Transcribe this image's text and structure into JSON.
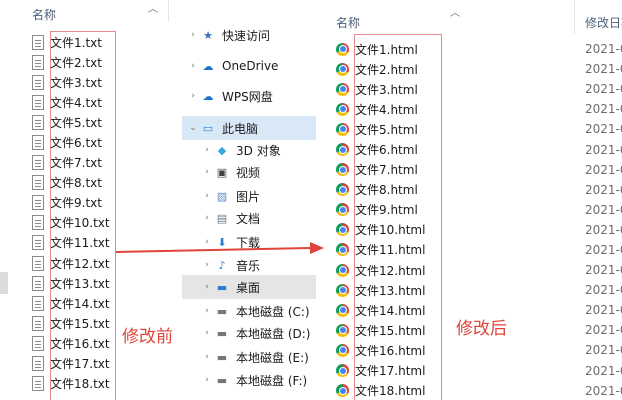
{
  "left_pane": {
    "column_header": "名称",
    "files": [
      "文件1.txt",
      "文件2.txt",
      "文件3.txt",
      "文件4.txt",
      "文件5.txt",
      "文件6.txt",
      "文件7.txt",
      "文件8.txt",
      "文件9.txt",
      "文件10.txt",
      "文件11.txt",
      "文件12.txt",
      "文件13.txt",
      "文件14.txt",
      "文件15.txt",
      "文件16.txt",
      "文件17.txt",
      "文件18.txt"
    ]
  },
  "nav_pane": {
    "items": [
      {
        "label": "快速访问",
        "icon": "star-icon"
      },
      {
        "label": "OneDrive",
        "icon": "cloud-icon"
      },
      {
        "label": "WPS网盘",
        "icon": "cloud-icon"
      },
      {
        "label": "此电脑",
        "icon": "computer-icon"
      },
      {
        "label": "3D 对象",
        "icon": "cube-icon"
      },
      {
        "label": "视频",
        "icon": "video-icon"
      },
      {
        "label": "图片",
        "icon": "image-icon"
      },
      {
        "label": "文档",
        "icon": "document-icon"
      },
      {
        "label": "下载",
        "icon": "download-icon"
      },
      {
        "label": "音乐",
        "icon": "music-icon"
      },
      {
        "label": "桌面",
        "icon": "desktop-icon"
      },
      {
        "label": "本地磁盘 (C:)",
        "icon": "drive-icon"
      },
      {
        "label": "本地磁盘 (D:)",
        "icon": "drive-icon"
      },
      {
        "label": "本地磁盘 (E:)",
        "icon": "drive-icon"
      },
      {
        "label": "本地磁盘 (F:)",
        "icon": "drive-icon"
      }
    ]
  },
  "right_pane": {
    "column_header_name": "名称",
    "column_header_date": "修改日期",
    "files": [
      "文件1.html",
      "文件2.html",
      "文件3.html",
      "文件4.html",
      "文件5.html",
      "文件6.html",
      "文件7.html",
      "文件8.html",
      "文件9.html",
      "文件10.html",
      "文件11.html",
      "文件12.html",
      "文件13.html",
      "文件14.html",
      "文件15.html",
      "文件16.html",
      "文件17.html",
      "文件18.html"
    ],
    "date_prefix": "2021-0"
  },
  "annotations": {
    "before": "修改前",
    "after": "修改后"
  },
  "colors": {
    "annotation_red": "#e0433a",
    "selected_root": "#d9e8f7",
    "selected_item": "#e5e5e5"
  }
}
